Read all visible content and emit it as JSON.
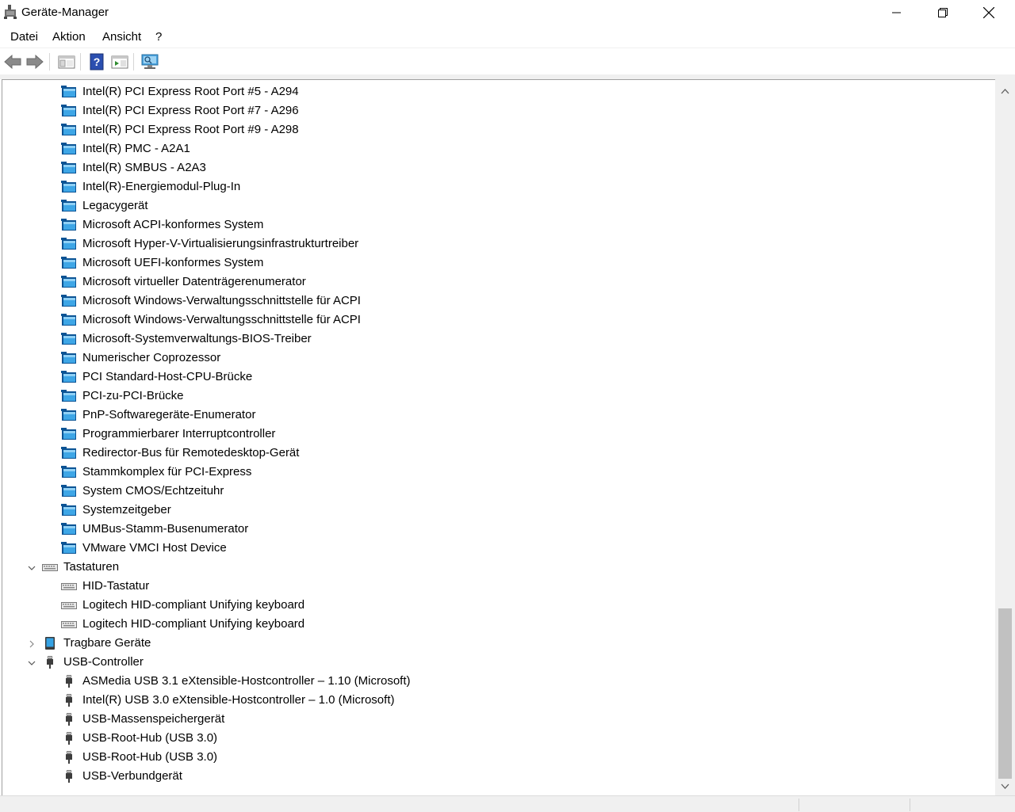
{
  "window": {
    "title": "Geräte-Manager",
    "buttons": [
      "minimize",
      "restore",
      "close"
    ]
  },
  "menu": [
    "Datei",
    "Aktion",
    "Ansicht",
    "?"
  ],
  "toolbar": {
    "buttons": [
      "back-arrow-icon",
      "forward-arrow-icon",
      "show-hide-console-tree-icon",
      "help-icon",
      "properties-icon",
      "scan-hardware-icon"
    ]
  },
  "tree": {
    "rows": [
      {
        "label": "Intel(R) PCI Express Root Port #5 - A294",
        "level": 2,
        "icon": "system-device-icon"
      },
      {
        "label": "Intel(R) PCI Express Root Port #7 - A296",
        "level": 2,
        "icon": "system-device-icon"
      },
      {
        "label": "Intel(R) PCI Express Root Port #9 - A298",
        "level": 2,
        "icon": "system-device-icon"
      },
      {
        "label": "Intel(R) PMC - A2A1",
        "level": 2,
        "icon": "system-device-icon"
      },
      {
        "label": "Intel(R) SMBUS - A2A3",
        "level": 2,
        "icon": "system-device-icon"
      },
      {
        "label": "Intel(R)-Energiemodul-Plug-In",
        "level": 2,
        "icon": "system-device-icon"
      },
      {
        "label": "Legacygerät",
        "level": 2,
        "icon": "system-device-icon"
      },
      {
        "label": "Microsoft ACPI-konformes System",
        "level": 2,
        "icon": "system-device-icon"
      },
      {
        "label": "Microsoft Hyper-V-Virtualisierungsinfrastrukturtreiber",
        "level": 2,
        "icon": "system-device-icon"
      },
      {
        "label": "Microsoft UEFI-konformes System",
        "level": 2,
        "icon": "system-device-icon"
      },
      {
        "label": "Microsoft virtueller Datenträgerenumerator",
        "level": 2,
        "icon": "system-device-icon"
      },
      {
        "label": "Microsoft Windows-Verwaltungsschnittstelle für ACPI",
        "level": 2,
        "icon": "system-device-icon"
      },
      {
        "label": "Microsoft Windows-Verwaltungsschnittstelle für ACPI",
        "level": 2,
        "icon": "system-device-icon"
      },
      {
        "label": "Microsoft-Systemverwaltungs-BIOS-Treiber",
        "level": 2,
        "icon": "system-device-icon"
      },
      {
        "label": "Numerischer Coprozessor",
        "level": 2,
        "icon": "system-device-icon"
      },
      {
        "label": "PCI Standard-Host-CPU-Brücke",
        "level": 2,
        "icon": "system-device-icon"
      },
      {
        "label": "PCI-zu-PCI-Brücke",
        "level": 2,
        "icon": "system-device-icon"
      },
      {
        "label": "PnP-Softwaregeräte-Enumerator",
        "level": 2,
        "icon": "system-device-icon"
      },
      {
        "label": "Programmierbarer Interruptcontroller",
        "level": 2,
        "icon": "system-device-icon"
      },
      {
        "label": "Redirector-Bus für Remotedesktop-Gerät",
        "level": 2,
        "icon": "system-device-icon"
      },
      {
        "label": "Stammkomplex für PCI-Express",
        "level": 2,
        "icon": "system-device-icon"
      },
      {
        "label": "System CMOS/Echtzeituhr",
        "level": 2,
        "icon": "system-device-icon"
      },
      {
        "label": "Systemzeitgeber",
        "level": 2,
        "icon": "system-device-icon"
      },
      {
        "label": "UMBus-Stamm-Busenumerator",
        "level": 2,
        "icon": "system-device-icon"
      },
      {
        "label": "VMware VMCI Host Device",
        "level": 2,
        "icon": "system-device-icon"
      },
      {
        "label": "Tastaturen",
        "level": 1,
        "icon": "keyboard-icon",
        "expander": "expanded"
      },
      {
        "label": "HID-Tastatur",
        "level": 2,
        "icon": "keyboard-icon"
      },
      {
        "label": "Logitech HID-compliant Unifying keyboard",
        "level": 2,
        "icon": "keyboard-icon"
      },
      {
        "label": "Logitech HID-compliant Unifying keyboard",
        "level": 2,
        "icon": "keyboard-icon"
      },
      {
        "label": "Tragbare Geräte",
        "level": 1,
        "icon": "portable-device-icon",
        "expander": "collapsed"
      },
      {
        "label": "USB-Controller",
        "level": 1,
        "icon": "usb-icon",
        "expander": "expanded"
      },
      {
        "label": "ASMedia USB 3.1 eXtensible-Hostcontroller – 1.10 (Microsoft)",
        "level": 2,
        "icon": "usb-icon"
      },
      {
        "label": "Intel(R) USB 3.0 eXtensible-Hostcontroller – 1.0 (Microsoft)",
        "level": 2,
        "icon": "usb-icon"
      },
      {
        "label": "USB-Massenspeichergerät",
        "level": 2,
        "icon": "usb-icon"
      },
      {
        "label": "USB-Root-Hub (USB 3.0)",
        "level": 2,
        "icon": "usb-icon"
      },
      {
        "label": "USB-Root-Hub (USB 3.0)",
        "level": 2,
        "icon": "usb-icon"
      },
      {
        "label": "USB-Verbundgerät",
        "level": 2,
        "icon": "usb-icon"
      }
    ]
  },
  "colors": {
    "folder_blue": "#1e90d8",
    "folder_dark": "#0b5394",
    "chrome_gray": "#f0f0f0",
    "scroll_thumb": "#c1c1c1"
  }
}
